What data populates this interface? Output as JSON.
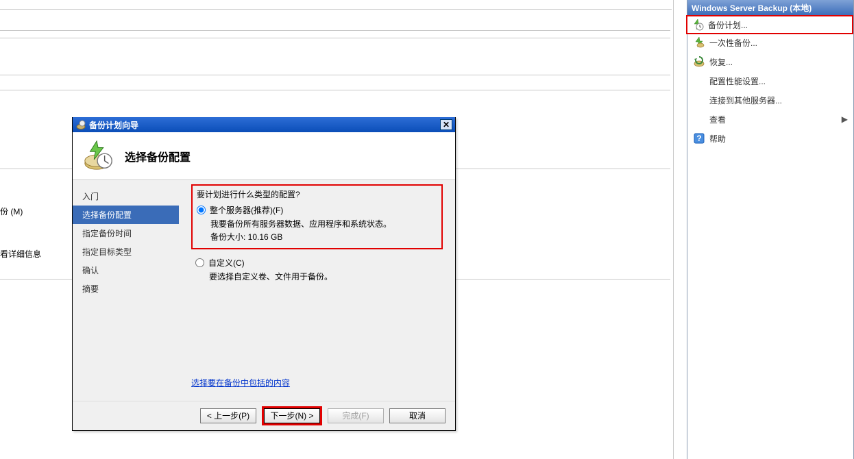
{
  "left_remnants": {
    "line1": "份 (M)",
    "line2": "看详细信息"
  },
  "actions_panel": {
    "title": "Windows Server Backup (本地)",
    "items": [
      {
        "label": "备份计划...",
        "highlighted": true,
        "icon": "schedule-icon"
      },
      {
        "label": "一次性备份...",
        "highlighted": false,
        "icon": "backup-once-icon"
      },
      {
        "label": "恢复...",
        "highlighted": false,
        "icon": "recover-icon"
      },
      {
        "label": "配置性能设置...",
        "highlighted": false,
        "icon": "none"
      },
      {
        "label": "连接到其他服务器...",
        "highlighted": false,
        "icon": "none"
      },
      {
        "label": "查看",
        "highlighted": false,
        "icon": "none",
        "has_arrow": true
      },
      {
        "label": "帮助",
        "highlighted": false,
        "icon": "help-icon"
      }
    ]
  },
  "wizard": {
    "title": "备份计划向导",
    "heading": "选择备份配置",
    "steps": [
      {
        "label": "入门",
        "active": false
      },
      {
        "label": "选择备份配置",
        "active": true
      },
      {
        "label": "指定备份时间",
        "active": false
      },
      {
        "label": "指定目标类型",
        "active": false
      },
      {
        "label": "确认",
        "active": false
      },
      {
        "label": "摘要",
        "active": false
      }
    ],
    "question": "要计划进行什么类型的配置?",
    "option1": {
      "label": "整个服务器(推荐)(F)",
      "desc": "我要备份所有服务器数据、应用程序和系统状态。",
      "size_label": "备份大小: 10.16 GB"
    },
    "option2": {
      "label": "自定义(C)",
      "desc": "要选择自定义卷、文件用于备份。"
    },
    "link": "选择要在备份中包括的内容",
    "buttons": {
      "back": "< 上一步(P)",
      "next": "下一步(N) >",
      "finish": "完成(F)",
      "cancel": "取消"
    }
  }
}
